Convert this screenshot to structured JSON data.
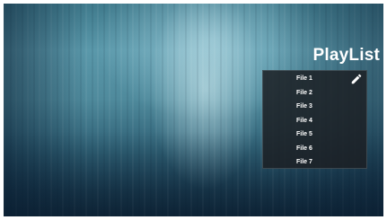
{
  "playlist": {
    "title": "PlayList",
    "edit_icon": "pencil-icon",
    "items": [
      {
        "label": "File 1"
      },
      {
        "label": "File 2"
      },
      {
        "label": "File 3"
      },
      {
        "label": "File 4"
      },
      {
        "label": "File 5"
      },
      {
        "label": "File 6"
      },
      {
        "label": "File 7"
      }
    ]
  }
}
